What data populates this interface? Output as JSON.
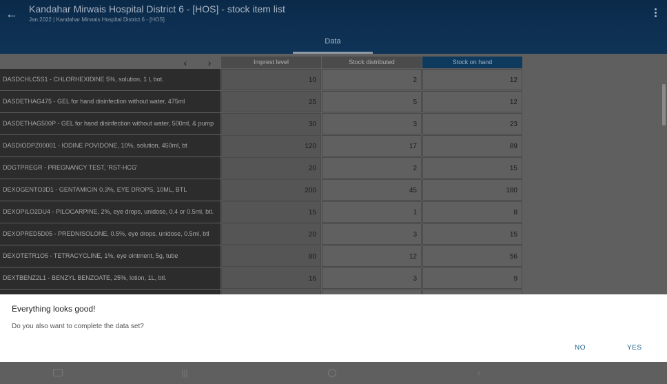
{
  "header": {
    "title": "Kandahar Mirwais Hospital District 6 -  [HOS] - stock item list",
    "subtitle": "Jan 2022 | Kandahar Mirwais Hospital District 6 - [HOS]",
    "tab_label": "Data",
    "back_icon": "arrow-left-icon",
    "menu_icon": "more-vert-icon"
  },
  "table": {
    "prev_icon": "chevron-left-icon",
    "next_icon": "chevron-right-icon",
    "columns": [
      "Imprest level",
      "Stock distributed",
      "Stock on hand"
    ],
    "rows": [
      {
        "label": "DASDCHLC5S1 - CHLORHEXIDINE 5%, solution, 1 l, bot.",
        "v": [
          "10",
          "2",
          "12"
        ]
      },
      {
        "label": "DASDETHAG475 - GEL for hand disinfection without water, 475ml",
        "v": [
          "25",
          "5",
          "12"
        ]
      },
      {
        "label": "DASDETHAG500P - GEL for hand disinfection without water, 500ml, & pump",
        "v": [
          "30",
          "3",
          "23"
        ]
      },
      {
        "label": "DASDIODPZ00001 - IODINE POVIDONE, 10%, solution, 450ml, bt",
        "v": [
          "120",
          "17",
          "89"
        ]
      },
      {
        "label": "DDGTPREGR - PREGNANCY TEST, 'RST-HCG'",
        "v": [
          "20",
          "2",
          "15"
        ]
      },
      {
        "label": "DEXOGENTO3D1 - GENTAMICIN 0.3%, EYE DROPS, 10ML, BTL",
        "v": [
          "200",
          "45",
          "180"
        ]
      },
      {
        "label": "DEXOPILO2DU4 - PILOCARPINE, 2%, eye drops, unidose, 0.4 or 0.5ml, btl.",
        "v": [
          "15",
          "1",
          "8"
        ]
      },
      {
        "label": "DEXOPRED5D05 - PREDNISOLONE, 0.5%, eye drops, unidose, 0.5ml, btl",
        "v": [
          "20",
          "3",
          "15"
        ]
      },
      {
        "label": "DEXOTETR1O5 - TETRACYCLINE, 1%, eye ointment, 5g, tube",
        "v": [
          "80",
          "12",
          "56"
        ]
      },
      {
        "label": "DEXTBENZ2L1 - BENZYL BENZOATE, 25%, lotion, 1L, btl.",
        "v": [
          "16",
          "3",
          "9"
        ]
      },
      {
        "label": "",
        "v": [
          "",
          "",
          ""
        ]
      }
    ]
  },
  "dialog": {
    "title": "Everything looks good!",
    "message": "Do you also want to complete the data set?",
    "no_label": "NO",
    "yes_label": "YES"
  },
  "navbar": {
    "icons": [
      "keyboard-icon",
      "recent-apps-icon",
      "home-icon",
      "back-icon"
    ]
  },
  "colors": {
    "header": "#0f3457",
    "accent": "#1c5f8f",
    "overlay": "#5f5f5f"
  }
}
